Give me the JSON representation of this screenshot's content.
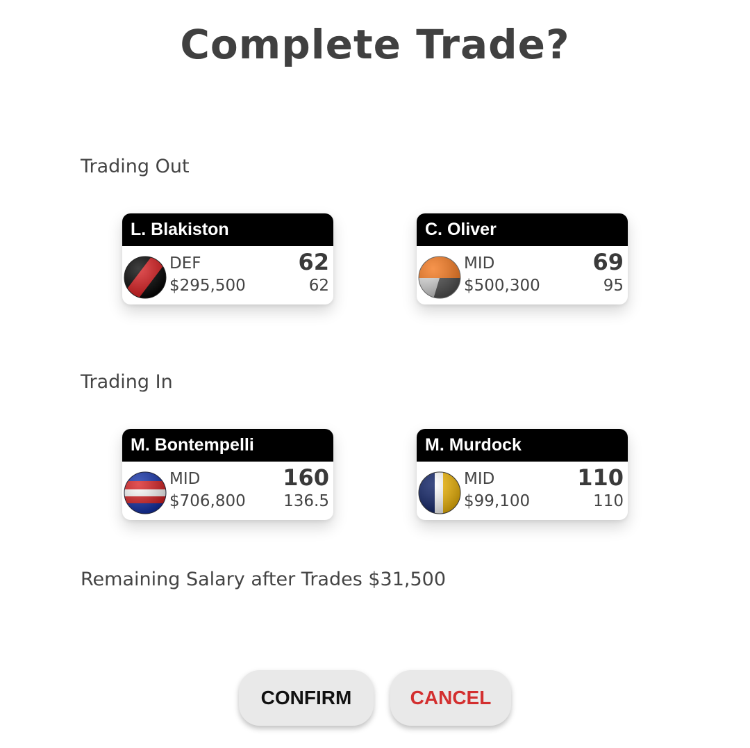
{
  "dialog": {
    "title": "Complete Trade?",
    "trading_out_label": "Trading Out",
    "trading_in_label": "Trading In",
    "remaining_salary": "Remaining Salary after Trades $31,500",
    "confirm_label": "CONFIRM",
    "cancel_label": "CANCEL"
  },
  "trading_out": [
    {
      "name": "L. Blakiston",
      "position": "DEF",
      "price": "$295,500",
      "score": "62",
      "average": "62",
      "icon": "essendon-guernsey-icon",
      "colors": [
        "#000000",
        "#d7191c"
      ]
    },
    {
      "name": "C. Oliver",
      "position": "MID",
      "price": "$500,300",
      "score": "69",
      "average": "95",
      "icon": "gws-guernsey-icon",
      "colors": [
        "#f47920",
        "#ffffff",
        "#4a4a4a"
      ]
    }
  ],
  "trading_in": [
    {
      "name": "M. Bontempelli",
      "position": "MID",
      "price": "$706,800",
      "score": "160",
      "average": "136.5",
      "icon": "bulldogs-guernsey-icon",
      "colors": [
        "#d7191c",
        "#ffffff",
        "#0d2ca8"
      ]
    },
    {
      "name": "M. Murdock",
      "position": "MID",
      "price": "$99,100",
      "score": "110",
      "average": "110",
      "icon": "west-coast-guernsey-icon",
      "colors": [
        "#0b1e63",
        "#ffffff",
        "#f2b705"
      ]
    }
  ]
}
